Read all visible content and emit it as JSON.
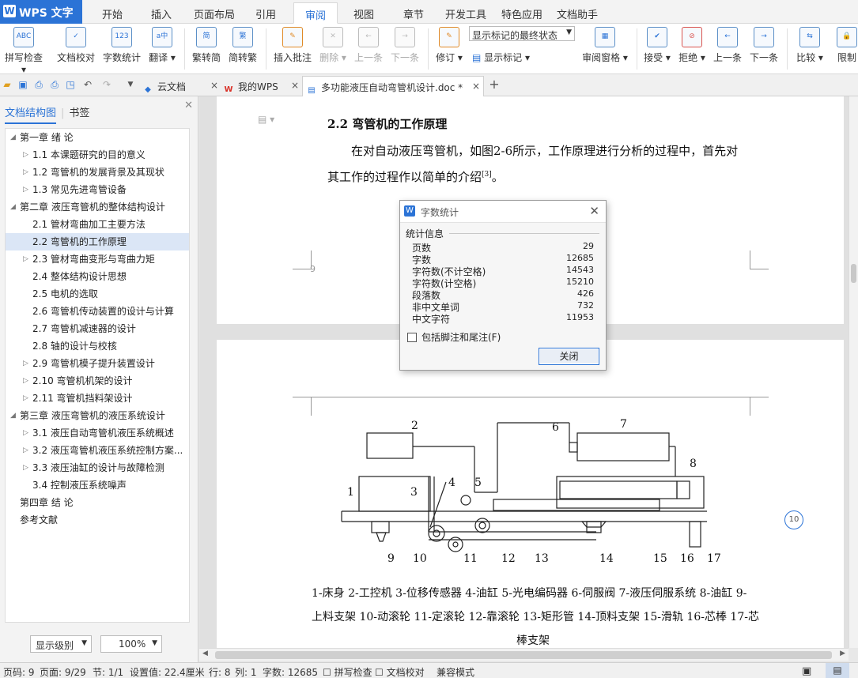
{
  "app": {
    "logo": "WPS 文字",
    "logo_glyph": "W"
  },
  "menu": [
    "开始",
    "插入",
    "页面布局",
    "引用",
    "审阅",
    "视图",
    "章节",
    "开发工具",
    "特色应用",
    "文档助手"
  ],
  "ribbon": {
    "spell_check": "拼写检查",
    "doc_proof": "文档校对",
    "word_count": "字数统计",
    "translate": "翻译",
    "trad_to_simp": "繁转简",
    "simp_to_trad": "简转繁",
    "insert_comment": "插入批注",
    "delete": "删除",
    "prev_comment": "上一条",
    "next_comment": "下一条",
    "revise": "修订",
    "show_markup": "显示标记",
    "markup_state": "显示标记的最终状态",
    "review_pane": "审阅窗格",
    "accept": "接受",
    "reject": "拒绝",
    "prev_change": "上一条",
    "next_change": "下一条",
    "compare": "比较",
    "restrict": "限制"
  },
  "tabs": {
    "cloud": "云文档",
    "mywps": "我的WPS",
    "doc": "多功能液压自动弯管机设计.doc *"
  },
  "nav": {
    "tab_outline": "文档结构图",
    "tab_bookmarks": "书签",
    "items": [
      {
        "label": "第一章  绪  论",
        "level": 1,
        "arrow": "down"
      },
      {
        "label": "1.1  本课题研究的目的意义",
        "level": 2,
        "arrow": "right"
      },
      {
        "label": "1.2  弯管机的发展背景及其现状",
        "level": 2,
        "arrow": "right"
      },
      {
        "label": "1.3  常见先进弯管设备",
        "level": 2,
        "arrow": "right"
      },
      {
        "label": "第二章  液压弯管机的整体结构设计",
        "level": 1,
        "arrow": "down"
      },
      {
        "label": "2.1  管材弯曲加工主要方法",
        "level": 2,
        "arrow": ""
      },
      {
        "label": "2.2  弯管机的工作原理",
        "level": 2,
        "arrow": "",
        "selected": true
      },
      {
        "label": "2.3  管材弯曲变形与弯曲力矩",
        "level": 2,
        "arrow": "right"
      },
      {
        "label": "2.4  整体结构设计思想",
        "level": 2,
        "arrow": ""
      },
      {
        "label": "2.5  电机的选取",
        "level": 2,
        "arrow": ""
      },
      {
        "label": "2.6  弯管机传动装置的设计与计算",
        "level": 2,
        "arrow": ""
      },
      {
        "label": "2.7  弯管机减速器的设计",
        "level": 2,
        "arrow": ""
      },
      {
        "label": "2.8  轴的设计与校核",
        "level": 2,
        "arrow": ""
      },
      {
        "label": "2.9  弯管机模子提升装置设计",
        "level": 2,
        "arrow": "right"
      },
      {
        "label": "2.10  弯管机机架的设计",
        "level": 2,
        "arrow": "right"
      },
      {
        "label": "2.11  弯管机挡料架设计",
        "level": 2,
        "arrow": "right"
      },
      {
        "label": "第三章  液压弯管机的液压系统设计",
        "level": 1,
        "arrow": "down"
      },
      {
        "label": "3.1  液压自动弯管机液压系统概述",
        "level": 2,
        "arrow": "right"
      },
      {
        "label": "3.2  液压弯管机液压系统控制方案...",
        "level": 2,
        "arrow": "right"
      },
      {
        "label": "3.3  液压油缸的设计与故障检测",
        "level": 2,
        "arrow": "right"
      },
      {
        "label": "3.4  控制液压系统噪声",
        "level": 2,
        "arrow": ""
      },
      {
        "label": "第四章  结  论",
        "level": 1,
        "arrow": ""
      },
      {
        "label": "参考文献",
        "level": 1,
        "arrow": ""
      }
    ],
    "level_combo": "显示级别",
    "zoom_combo": "100%"
  },
  "doc": {
    "heading": "2.2  弯管机的工作原理",
    "para1": "在对自动液压弯管机，如图2-6所示，工作原理进行分析的过程中，首先对",
    "para2": "其工作的过程作以简单的介绍",
    "para2_sup": "[3]",
    "para2_end": "。",
    "page_num_left": "9",
    "page_num_right": "10",
    "caption1": "1-床身  2-工控机  3-位移传感器  4-油缸  5-光电编码器  6-伺服阀  7-液压伺服系统  8-油缸  9-",
    "caption2": "上料支架  10-动滚轮  11-定滚轮  12-靠滚轮  13-矩形管  14-顶料支架  15-滑轨  16-芯棒  17-芯",
    "caption3": "棒支架",
    "diagram_labels": [
      "1",
      "2",
      "3",
      "4",
      "5",
      "6",
      "7",
      "8",
      "9",
      "10",
      "11",
      "12",
      "13",
      "14",
      "15",
      "16",
      "17"
    ]
  },
  "dialog": {
    "title": "字数统计",
    "group": "统计信息",
    "stats": [
      {
        "label": "页数",
        "value": "29"
      },
      {
        "label": "字数",
        "value": "12685"
      },
      {
        "label": "字符数(不计空格)",
        "value": "14543"
      },
      {
        "label": "字符数(计空格)",
        "value": "15210"
      },
      {
        "label": "段落数",
        "value": "426"
      },
      {
        "label": "非中文单词",
        "value": "732"
      },
      {
        "label": "中文字符",
        "value": "11953"
      }
    ],
    "checkbox": "包括脚注和尾注(F)",
    "close_btn": "关闭"
  },
  "status": {
    "page_code": "页码: 9",
    "page": "页面: 9/29",
    "section": "节: 1/1",
    "setting": "设置值: 22.4厘米",
    "row": "行: 8",
    "col": "列: 1",
    "wordcount": "字数: 12685",
    "spell": "拼写检查",
    "proof": "文档校对",
    "compat": "兼容模式"
  },
  "colors": {
    "brand": "#2b73d6",
    "selected": "#dbe6f6"
  }
}
